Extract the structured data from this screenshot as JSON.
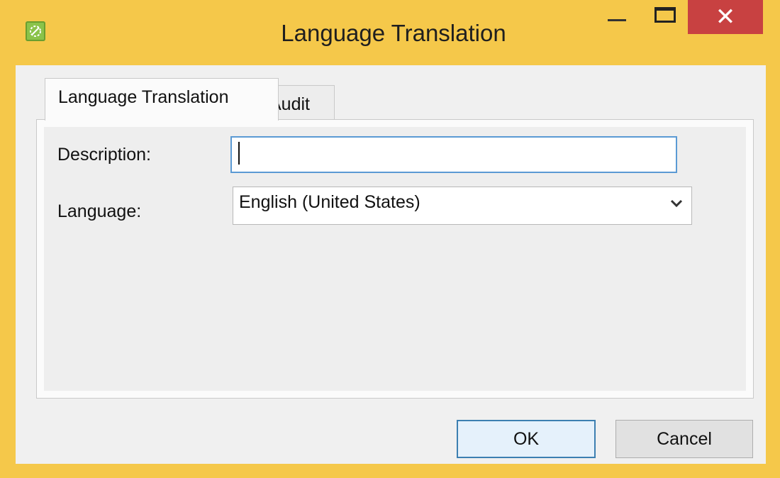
{
  "window": {
    "title": "Language Translation",
    "close_glyph": "✕",
    "colors": {
      "frame": "#f5c84a",
      "close": "#c84141",
      "focus": "#5b9ad4"
    }
  },
  "tabs": [
    {
      "label": "Language Translation",
      "active": true
    },
    {
      "label": "Audit",
      "active": false
    }
  ],
  "form": {
    "description_label": "Description:",
    "description_value": "",
    "language_label": "Language:",
    "language_value": "English (United States)"
  },
  "buttons": {
    "ok_label": "OK",
    "cancel_label": "Cancel"
  },
  "icons": [
    "app-icon",
    "minimize-icon",
    "maximize-icon",
    "close-icon",
    "chevron-down-icon"
  ]
}
